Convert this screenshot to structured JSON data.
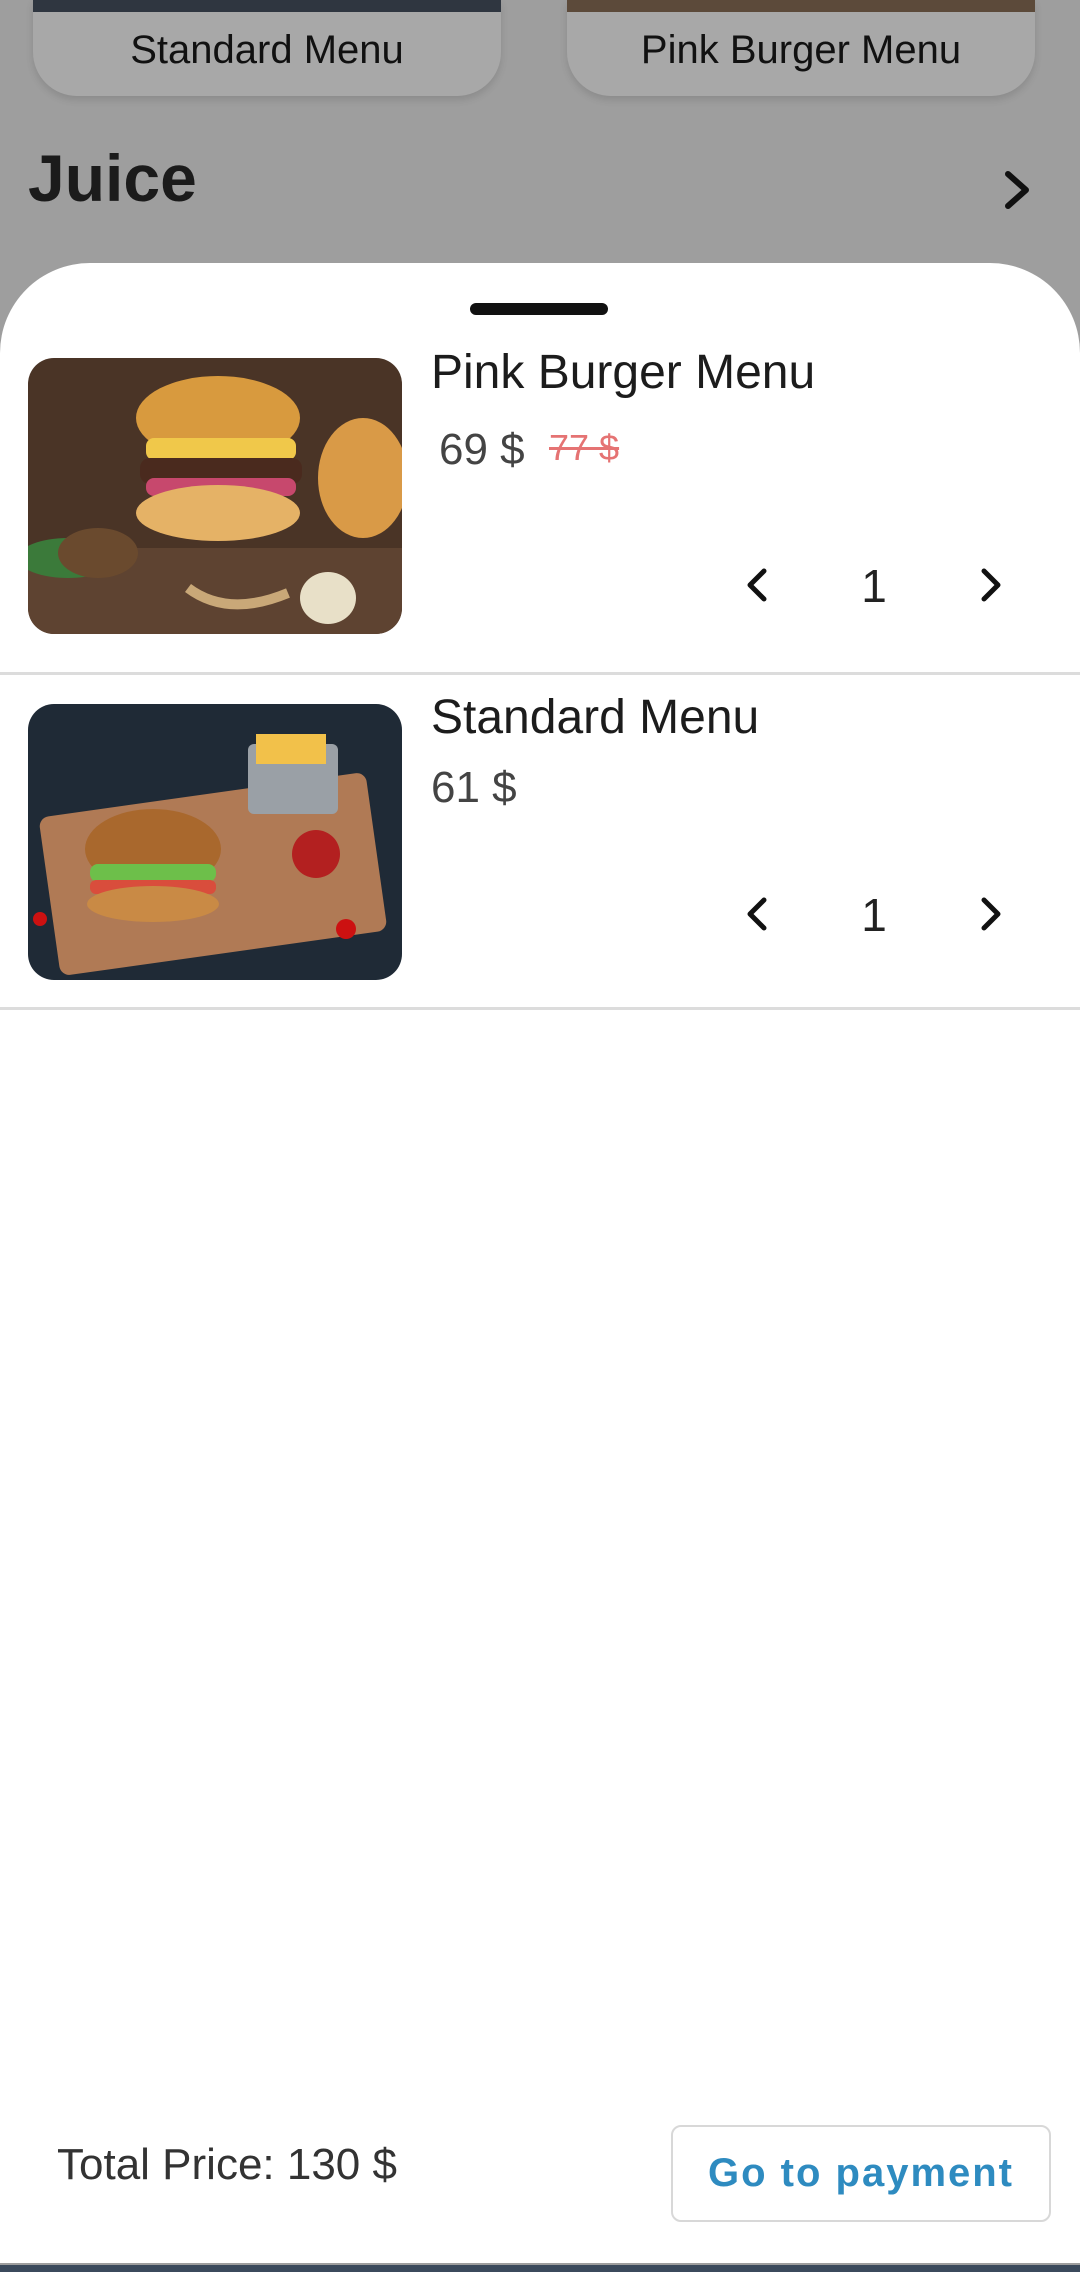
{
  "background": {
    "menu_cards": [
      {
        "label": "Standard Menu"
      },
      {
        "label": "Pink Burger Menu"
      }
    ],
    "section_title": "Juice"
  },
  "cart": {
    "items": [
      {
        "name": "Pink Burger Menu",
        "price": "69 $",
        "old_price": "77 $",
        "quantity": "1",
        "image": "burger-with-salad-photo"
      },
      {
        "name": "Standard Menu",
        "price": "61 $",
        "quantity": "1",
        "image": "burger-fries-tray-photo"
      }
    ],
    "total_label": "Total Price: 130 $",
    "pay_button": "Go to payment"
  },
  "colors": {
    "accent": "#2e8bc0",
    "old_price": "#e57373",
    "scrim": "#9e9e9e"
  }
}
